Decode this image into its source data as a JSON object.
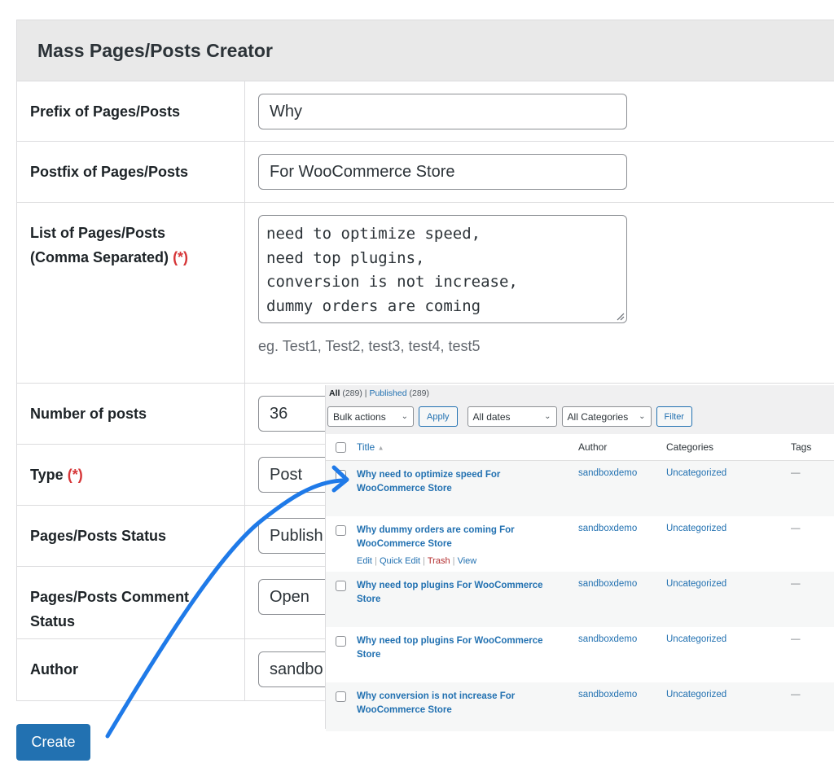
{
  "form": {
    "title": "Mass Pages/Posts Creator",
    "required_marker": "(*)",
    "fields": {
      "prefix": {
        "label": "Prefix of Pages/Posts",
        "value": "Why"
      },
      "postfix": {
        "label": "Postfix of Pages/Posts",
        "value": "For WooCommerce Store"
      },
      "list": {
        "label_line1": "List of Pages/Posts",
        "label_line2": "(Comma Separated)",
        "value": "need to optimize speed,\nneed top plugins,\nconversion is not increase,\ndummy orders are coming",
        "hint": "eg. Test1, Test2, test3, test4, test5"
      },
      "number": {
        "label": "Number of posts",
        "value": "36"
      },
      "type": {
        "label": "Type",
        "value": "Post"
      },
      "status": {
        "label": "Pages/Posts Status",
        "value": "Publish"
      },
      "comment_status": {
        "label_line1": "Pages/Posts Comment",
        "label_line2": "Status",
        "value": "Open"
      },
      "author": {
        "label": "Author",
        "value": "sandbo"
      }
    },
    "create_label": "Create"
  },
  "posts_list": {
    "filters": {
      "all_label": "All",
      "all_count": "(289)",
      "separator": "|",
      "published_label": "Published",
      "published_count": "(289)"
    },
    "toolbar": {
      "bulk_actions": "Bulk actions",
      "apply": "Apply",
      "dates": "All dates",
      "categories": "All Categories",
      "filter": "Filter"
    },
    "columns": {
      "title": "Title",
      "author": "Author",
      "categories": "Categories",
      "tags": "Tags"
    },
    "row_actions": {
      "edit": "Edit",
      "quick_edit": "Quick Edit",
      "trash": "Trash",
      "view": "View"
    },
    "rows": [
      {
        "title": "Why need to optimize speed For WooCommerce Store",
        "author": "sandboxdemo",
        "category": "Uncategorized",
        "tags": "—"
      },
      {
        "title": "Why dummy orders are coming For WooCommerce Store",
        "author": "sandboxdemo",
        "category": "Uncategorized",
        "tags": "—"
      },
      {
        "title": "Why need top plugins For WooCommerce Store",
        "author": "sandboxdemo",
        "category": "Uncategorized",
        "tags": "—"
      },
      {
        "title": "Why need top plugins For WooCommerce Store",
        "author": "sandboxdemo",
        "category": "Uncategorized",
        "tags": "—"
      },
      {
        "title": "Why conversion is not increase For WooCommerce Store",
        "author": "sandboxdemo",
        "category": "Uncategorized",
        "tags": "—"
      }
    ]
  },
  "colors": {
    "accent": "#2271b1",
    "required": "#d63638",
    "arrow": "#1f7ae8",
    "trash": "#b32d2e"
  }
}
